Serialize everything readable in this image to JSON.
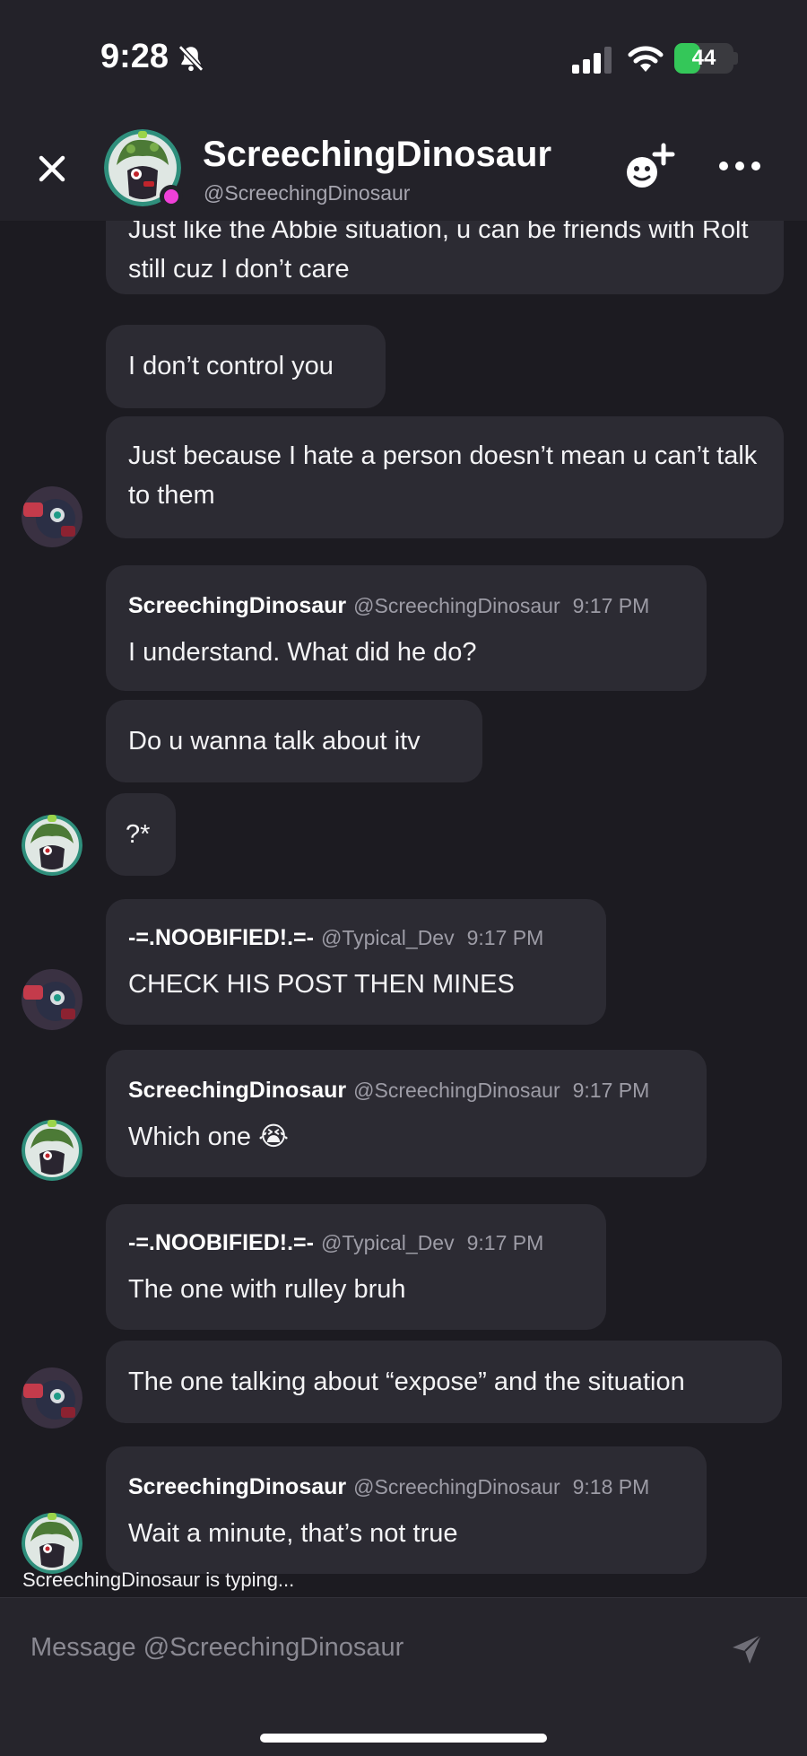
{
  "status_bar": {
    "time": "9:28",
    "battery": "44",
    "battery_level": 0.44
  },
  "header": {
    "display_name": "ScreechingDinosaur",
    "username": "@ScreechingDinosaur",
    "status_color": "#f040d8"
  },
  "messages": [
    {
      "text": "Just like the Abbie situation, u can be friends with Rolt still cuz I don’t care"
    },
    {
      "text": "I don’t control you"
    },
    {
      "text": "Just because I hate a person doesn’t mean u can’t talk to them"
    },
    {
      "author": "ScreechingDinosaur",
      "handle": "@ScreechingDinosaur",
      "time": "9:17 PM",
      "text": "I understand. What did he do?"
    },
    {
      "text": "Do u wanna talk about itv"
    },
    {
      "text": "?*"
    },
    {
      "author": "-=.NOOBIFIED!.=-",
      "handle": "@Typical_Dev",
      "time": "9:17 PM",
      "text": "CHECK HIS POST THEN MINES"
    },
    {
      "author": "ScreechingDinosaur",
      "handle": "@ScreechingDinosaur",
      "time": "9:17 PM",
      "text": "Which one 😭"
    },
    {
      "author": "-=.NOOBIFIED!.=-",
      "handle": "@Typical_Dev",
      "time": "9:17 PM",
      "text": "The one with rulley bruh"
    },
    {
      "text": "The one talking about “expose” and the situation"
    },
    {
      "author": "ScreechingDinosaur",
      "handle": "@ScreechingDinosaur",
      "time": "9:18 PM",
      "text": "Wait a minute, that’s not true"
    }
  ],
  "typing_indicator": "ScreechingDinosaur is typing...",
  "composer": {
    "placeholder": "Message @ScreechingDinosaur"
  },
  "icons": {
    "close": "close-icon",
    "add_friend": "add-friend-icon",
    "more": "more-icon",
    "send": "send-icon",
    "bell_off": "bell-off-icon",
    "signal": "signal-icon",
    "wifi": "wifi-icon"
  }
}
